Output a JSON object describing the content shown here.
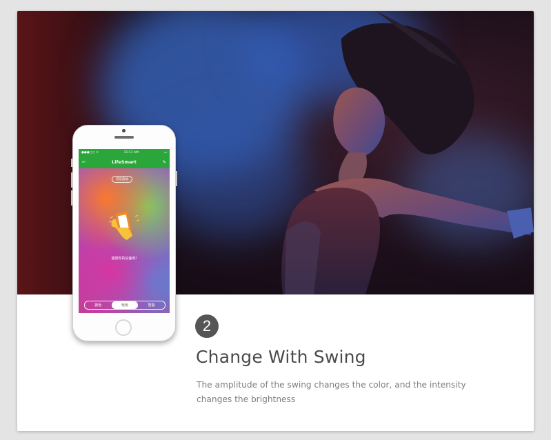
{
  "phone": {
    "status_time": "11:11 AM",
    "app_title": "LifeSmart",
    "mode_label": "音乐韵动",
    "hint": "摇晃你的设备吧!",
    "tabs": [
      "颜色",
      "玩玩",
      "智能"
    ],
    "active_tab_index": 1,
    "theme_color": "#2aa63a"
  },
  "step": {
    "number": "2",
    "title": "Change With Swing",
    "description_line1": "The amplitude of the swing changes the color, and the intensity",
    "description_line2": "changes the brightness"
  },
  "colors": {
    "badge": "#555555",
    "title": "#4a4a4a",
    "description": "#7d7d7d"
  }
}
